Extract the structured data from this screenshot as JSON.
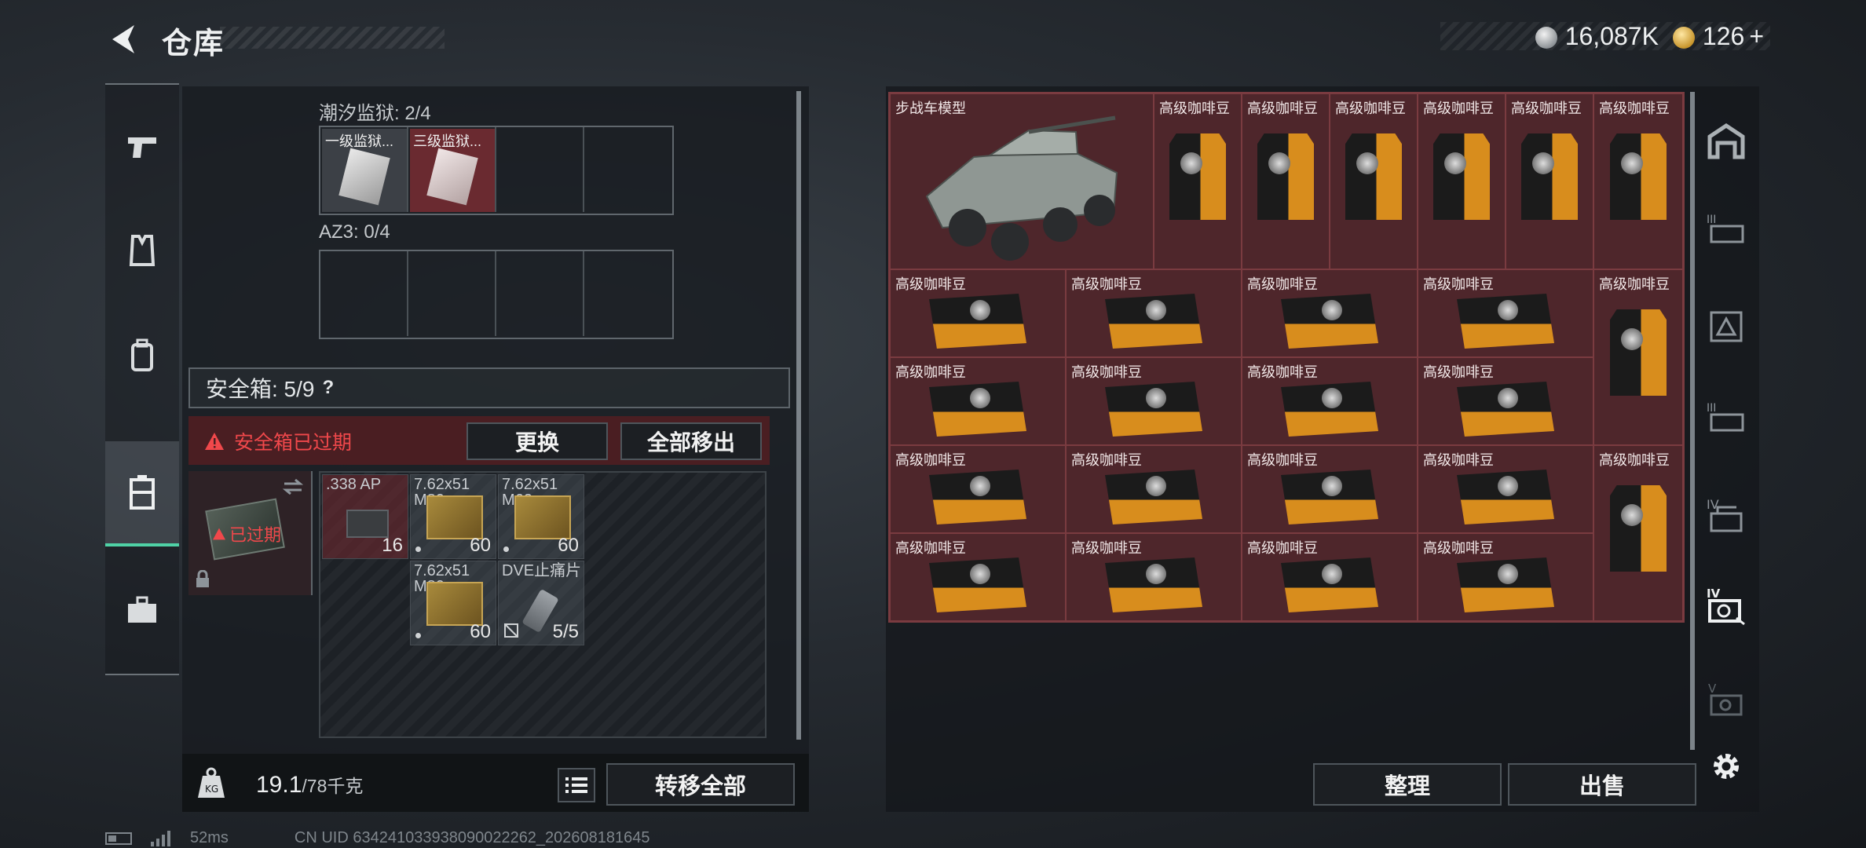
{
  "header": {
    "title": "仓库",
    "currency_silver": "16,087K",
    "currency_gold": "126",
    "gold_plus": "+"
  },
  "left_panel": {
    "group1": {
      "label": "潮汐监狱: 2/4",
      "items": [
        "一级监狱...",
        "三级监狱..."
      ]
    },
    "group2": {
      "label": "AZ3: 0/4"
    },
    "safe_box": {
      "label": "安全箱: 5/9",
      "help": "?",
      "expired_alert": "安全箱已过期",
      "replace_button": "更换",
      "move_all_button": "全部移出",
      "thumb_expired": "已过期"
    },
    "ammo": [
      {
        "name": ".338 AP",
        "count": "16"
      },
      {
        "name": "7.62x51 M80",
        "count": "60"
      },
      {
        "name": "7.62x51 M62",
        "count": "60"
      },
      {
        "name": "7.62x51 M80",
        "count": "60"
      },
      {
        "name": "DVE止痛片",
        "count": "5/5"
      }
    ],
    "weight": {
      "current": "19.1",
      "capacity": "/78千克"
    },
    "transfer_all_button": "转移全部"
  },
  "warehouse": {
    "vehicle_name": "步战车模型",
    "coffee_label": "高级咖啡豆",
    "sort_button": "整理",
    "sell_button": "出售"
  },
  "status": {
    "ping": "52ms",
    "uid": "CN UID 634241033938090022262_202608181645"
  },
  "colors": {
    "accent_teal": "#4fd2a6",
    "alert_red": "#f0484b",
    "warehouse_cell": "#4e262b"
  }
}
